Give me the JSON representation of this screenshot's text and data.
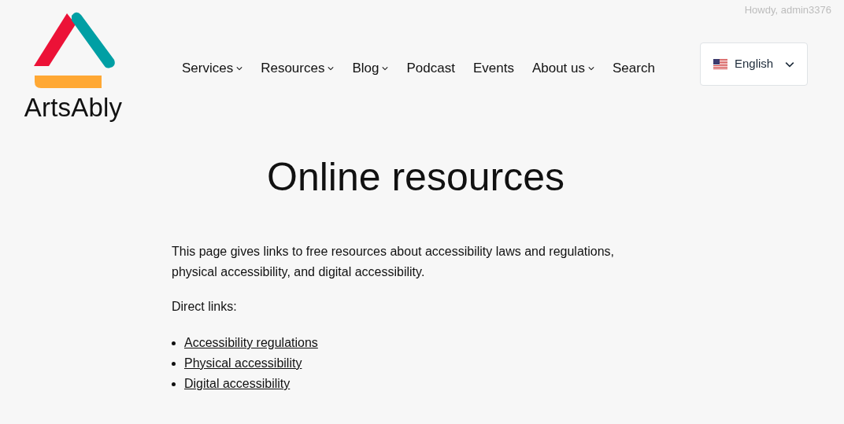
{
  "admin_bar": {
    "greeting": "Howdy, admin3376"
  },
  "logo": {
    "text": "ArtsAbly"
  },
  "nav": [
    {
      "label": "Services",
      "submenu": true
    },
    {
      "label": "Resources",
      "submenu": true
    },
    {
      "label": "Blog",
      "submenu": true
    },
    {
      "label": "Podcast",
      "submenu": false
    },
    {
      "label": "Events",
      "submenu": false
    },
    {
      "label": "About us",
      "submenu": true
    },
    {
      "label": "Search",
      "submenu": false
    }
  ],
  "language": {
    "label": "English"
  },
  "title": "Online resources",
  "intro": "This page gives links to free resources about accessibility laws and regulations, physical accessibility, and digital accessibility.",
  "direct_links_label": "Direct links:",
  "links": [
    "Accessibility regulations",
    "Physical accessibility",
    "Digital accessibility"
  ]
}
